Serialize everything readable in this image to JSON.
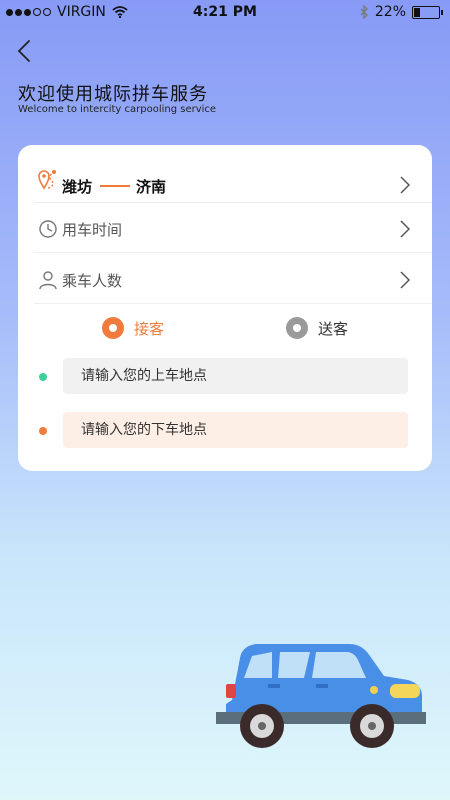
{
  "status_bar": {
    "carrier": "VIRGIN",
    "time": "4:21 PM",
    "battery": "22%",
    "battery_level": 0.22
  },
  "header": {
    "title": "欢迎使用城际拼车服务",
    "subtitle": "Welcome to intercity carpooling service"
  },
  "route": {
    "from": "潍坊",
    "to": "济南"
  },
  "options": {
    "time_label": "用车时间",
    "passengers_label": "乘车人数"
  },
  "service": {
    "pickup_label": "接客",
    "dropoff_label": "送客"
  },
  "inputs": {
    "pickup_placeholder": "请输入您的上车地点",
    "dropoff_placeholder": "请输入您的下车地点"
  },
  "colors": {
    "accent": "#f07b3d",
    "pickup_dot": "#3ecf9a",
    "dropoff_dot": "#f07b3d",
    "radio_inactive": "#9a9a9a"
  }
}
